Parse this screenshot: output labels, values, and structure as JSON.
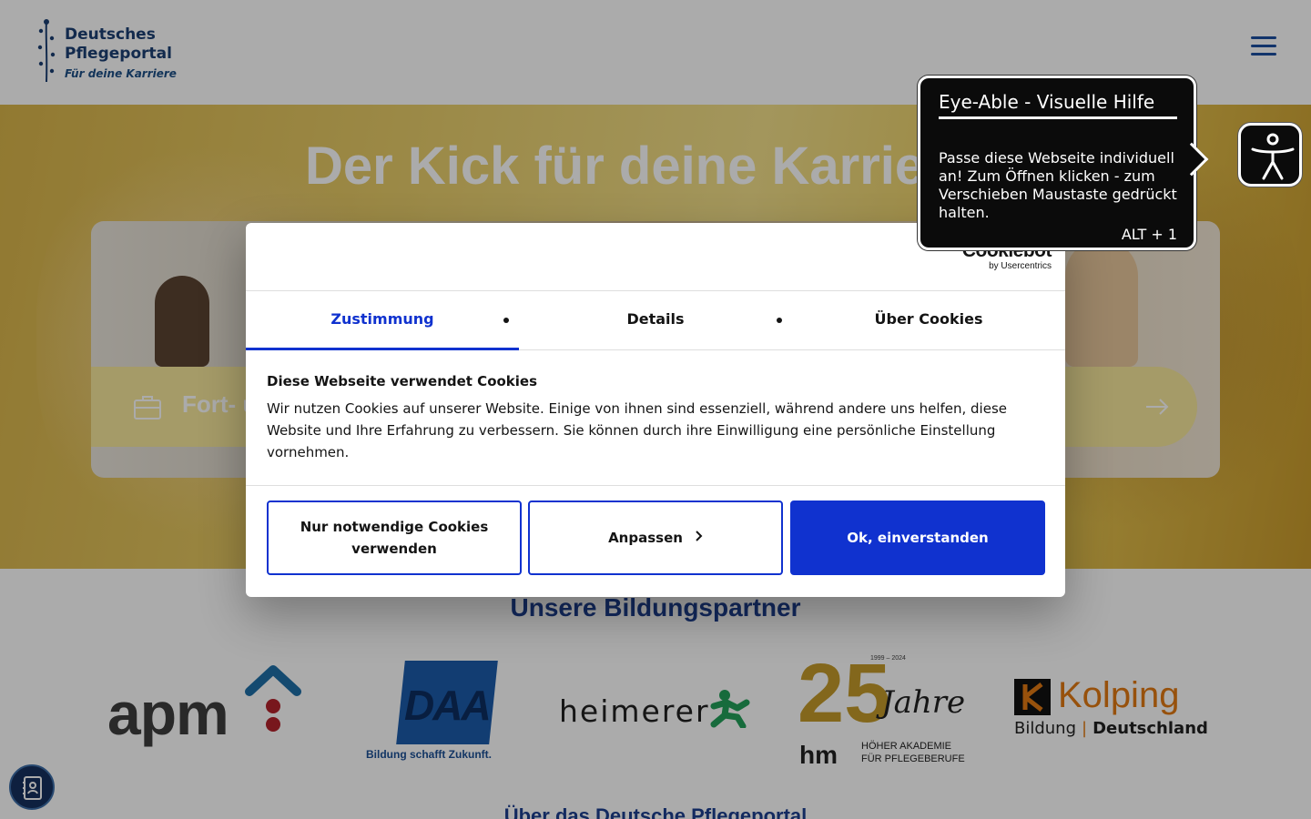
{
  "header": {
    "logo_line1": "Deutsches",
    "logo_line2": "Pflegeportal",
    "logo_tagline": "Für deine Karriere",
    "menu_icon": "hamburger-menu-icon"
  },
  "hero": {
    "title": "Der Kick für deine Karriere",
    "card_label": "Fort- und Weiterbildung",
    "card_icon": "briefcase-icon",
    "card_arrow_icon": "arrow-right-icon"
  },
  "partners": {
    "title": "Unsere Bildungspartner",
    "items": [
      {
        "name": "apm",
        "logo_text": "apm"
      },
      {
        "name": "DAA",
        "logo_text": "DAA",
        "tagline": "Bildung schafft Zukunft."
      },
      {
        "name": "heimerer",
        "logo_text": "heimerer"
      },
      {
        "name": "Höher Akademie",
        "logo_number": "25",
        "logo_script": "Jahre",
        "years": "1999 – 2024",
        "mark": "hm",
        "line1": "HÖHER AKADEMIE",
        "line2": "FÜR PFLEGEBERUFE"
      },
      {
        "name": "Kolping",
        "logo_text": "Kolping",
        "sub_left": "Bildung",
        "sub_sep": "|",
        "sub_right": "Deutschland"
      }
    ]
  },
  "about": {
    "title": "Über das Deutsche Pflegeportal"
  },
  "contact_fab": {
    "icon": "contact-book-icon"
  },
  "cookie_dialog": {
    "brand": "Cookiebot",
    "brand_sub": "by Usercentrics",
    "tabs": [
      {
        "label": "Zustimmung",
        "active": true
      },
      {
        "label": "Details",
        "active": false
      },
      {
        "label": "Über Cookies",
        "active": false
      }
    ],
    "title": "Diese Webseite verwendet Cookies",
    "text": "Wir nutzen Cookies auf unserer Website. Einige von ihnen sind essenziell, während andere uns helfen, diese Website und Ihre Erfahrung zu verbessern. Sie können durch ihre Einwilligung eine persönliche Einstellung vornehmen.",
    "buttons": {
      "necessary": "Nur notwendige Cookies verwenden",
      "customize": "Anpassen",
      "customize_icon": "chevron-right-icon",
      "accept": "Ok, einverstanden"
    },
    "accent_color": "#1032cf"
  },
  "eye_able": {
    "title": "Eye-Able - Visuelle Hilfe",
    "text": "Passe diese Webseite individuell an! Zum Öffnen klicken - zum Verschieben Maustaste gedrückt halten.",
    "shortcut": "ALT + 1",
    "icon": "accessibility-person-icon"
  }
}
